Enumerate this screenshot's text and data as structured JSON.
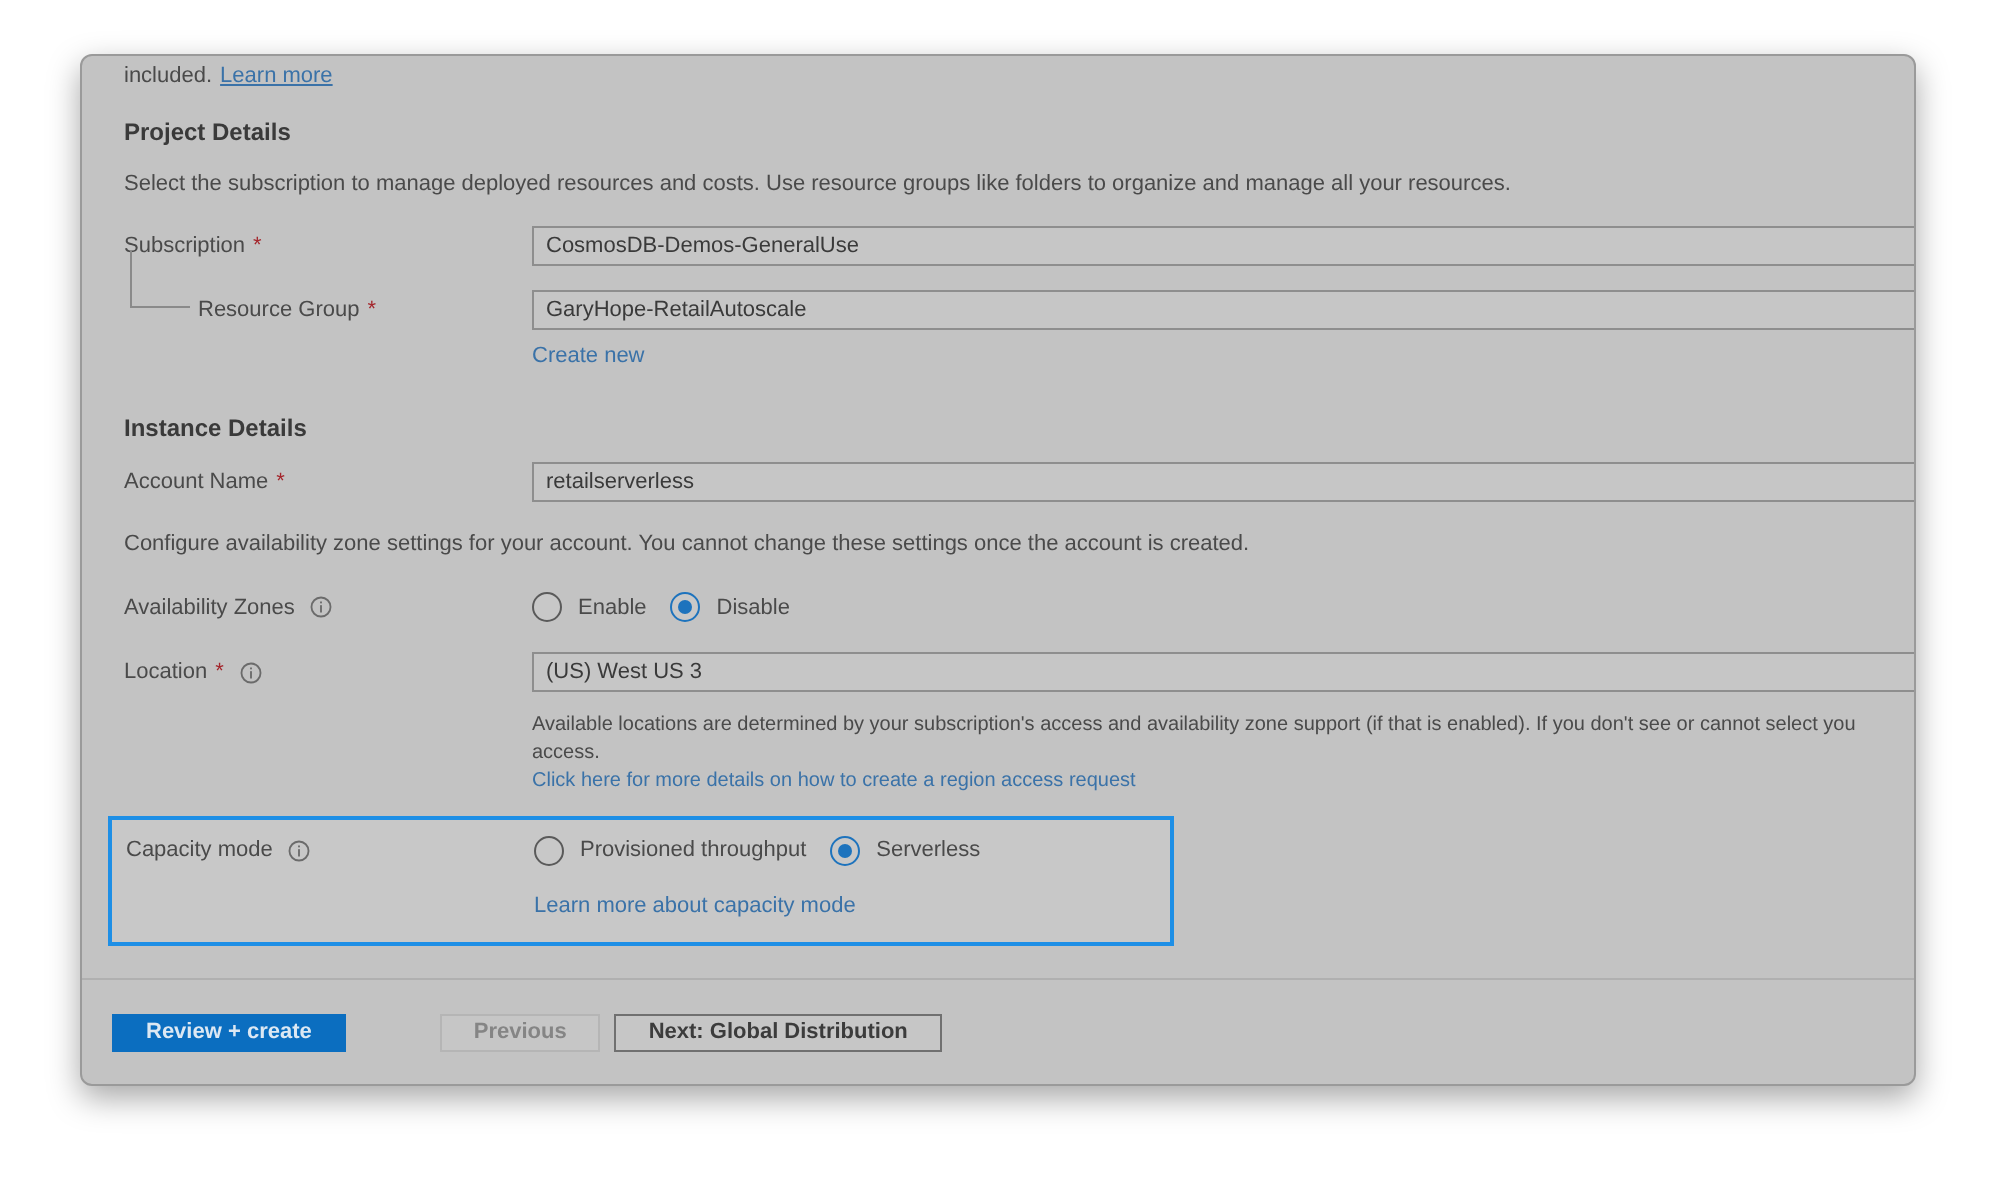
{
  "intro": {
    "text": "included.",
    "link": "Learn more"
  },
  "sections": [
    {
      "title": "Project Details",
      "items": [
        {
          "kind": "paragraph",
          "text": "Select the subscription to manage deployed resources and costs. Use resource groups like folders to organize and manage all your resources."
        },
        {
          "kind": "field",
          "label": "Subscription",
          "required_mark": "*",
          "indent": false,
          "value": "CosmosDB-Demos-GeneralUse"
        },
        {
          "kind": "field",
          "label": "Resource Group",
          "required_mark": "*",
          "indent": true,
          "value": "GaryHope-RetailAutoscale",
          "link": "Create new"
        }
      ]
    },
    {
      "title": "Instance Details",
      "items": [
        {
          "kind": "field",
          "label": "Account Name",
          "required_mark": "*",
          "indent": false,
          "value": "retailserverless"
        },
        {
          "kind": "paragraph",
          "text": "Configure availability zone settings for your account. You cannot change these settings once the account is created."
        },
        {
          "kind": "radio",
          "label": "Availability Zones",
          "info": true,
          "highlighted": false,
          "options": [
            {
              "label": "Enable",
              "selected": false
            },
            {
              "label": "Disable",
              "selected": true
            }
          ]
        },
        {
          "kind": "field",
          "label": "Location",
          "required_mark": "*",
          "info": true,
          "indent": false,
          "value": "(US) West US 3",
          "help": [
            "Available locations are determined by your subscription's access and availability zone support (if that is enabled). If you don't see or cannot select you",
            "access."
          ],
          "help_link": "Click here for more details on how to create a region access request"
        },
        {
          "kind": "radio",
          "label": "Capacity mode",
          "info": true,
          "highlighted": true,
          "options": [
            {
              "label": "Provisioned throughput",
              "selected": false
            },
            {
              "label": "Serverless",
              "selected": true
            }
          ],
          "link": "Learn more about capacity mode"
        }
      ]
    }
  ],
  "buttons": [
    {
      "label": "Review + create",
      "kind": "primary",
      "disabled": false
    },
    {
      "label": "Previous",
      "kind": "secondary",
      "disabled": true
    },
    {
      "label": "Next: Global Distribution",
      "kind": "secondary",
      "disabled": false
    }
  ]
}
